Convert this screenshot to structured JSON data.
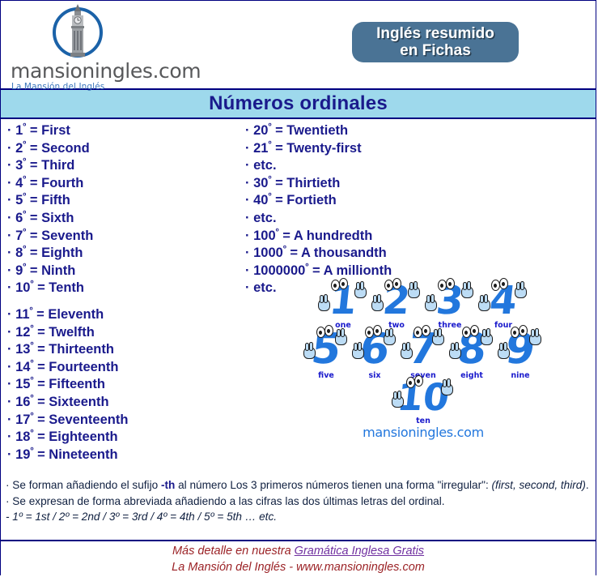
{
  "brand": {
    "name": "mansioningles.com",
    "tagline": "La Mansión del Inglés",
    "logo_icon": "big-ben-clock-tower-icon"
  },
  "header": {
    "badge_line1": "Inglés resumido",
    "badge_line2": "en Fichas",
    "badge_color": "#4a7395"
  },
  "title": {
    "text": "Números ordinales",
    "band_color": "#9ed9ec",
    "text_color": "#1a1a8c"
  },
  "columns": {
    "left": [
      {
        "bullet": "·",
        "num": "1",
        "ord": "º",
        "eq": "=",
        "word": "First"
      },
      {
        "bullet": "·",
        "num": "2",
        "ord": "º",
        "eq": "=",
        "word": "Second"
      },
      {
        "bullet": "·",
        "num": "3",
        "ord": "º",
        "eq": "=",
        "word": "Third"
      },
      {
        "bullet": "·",
        "num": "4",
        "ord": "º",
        "eq": "=",
        "word": "Fourth"
      },
      {
        "bullet": "·",
        "num": "5",
        "ord": "º",
        "eq": "=",
        "word": "Fifth"
      },
      {
        "bullet": "·",
        "num": "6",
        "ord": "º",
        "eq": "=",
        "word": "Sixth"
      },
      {
        "bullet": "·",
        "num": "7",
        "ord": "º",
        "eq": "=",
        "word": "Seventh"
      },
      {
        "bullet": "·",
        "num": "8",
        "ord": "º",
        "eq": "=",
        "word": "Eighth"
      },
      {
        "bullet": "·",
        "num": "9",
        "ord": "º",
        "eq": "=",
        "word": "Ninth"
      },
      {
        "bullet": "·",
        "num": "10",
        "ord": "º",
        "eq": "=",
        "word": "Tenth"
      },
      {
        "spacer": true
      },
      {
        "bullet": "·",
        "num": "11",
        "ord": "º",
        "eq": "=",
        "word": "Eleventh"
      },
      {
        "bullet": "·",
        "num": "12",
        "ord": "º",
        "eq": "=",
        "word": "Twelfth"
      },
      {
        "bullet": "·",
        "num": "13",
        "ord": "º",
        "eq": "=",
        "word": "Thirteenth"
      },
      {
        "bullet": "·",
        "num": "14",
        "ord": "º",
        "eq": "=",
        "word": "Fourteenth"
      },
      {
        "bullet": "·",
        "num": "15",
        "ord": "º",
        "eq": "=",
        "word": "Fifteenth"
      },
      {
        "bullet": "·",
        "num": "16",
        "ord": "º",
        "eq": "=",
        "word": "Sixteenth"
      },
      {
        "bullet": "·",
        "num": "17",
        "ord": "º",
        "eq": "=",
        "word": "Seventeenth"
      },
      {
        "bullet": "·",
        "num": "18",
        "ord": "º",
        "eq": "=",
        "word": "Eighteenth"
      },
      {
        "bullet": "·",
        "num": "19",
        "ord": "º",
        "eq": "=",
        "word": "Nineteenth"
      }
    ],
    "right": [
      {
        "bullet": "·",
        "num": "20",
        "ord": "º",
        "eq": "=",
        "word": "Twentieth"
      },
      {
        "bullet": "·",
        "num": "21",
        "ord": "º",
        "eq": "=",
        "word": "Twenty-first"
      },
      {
        "bullet": "·",
        "text": "etc."
      },
      {
        "bullet": "·",
        "num": "30",
        "ord": "º",
        "eq": "=",
        "word": "Thirtieth"
      },
      {
        "bullet": "·",
        "num": "40",
        "ord": "º",
        "eq": "=",
        "word": "Fortieth"
      },
      {
        "bullet": "·",
        "text": "etc."
      },
      {
        "bullet": "·",
        "num": "100",
        "ord": "º",
        "eq": "=",
        "word": "A hundredth"
      },
      {
        "bullet": "·",
        "num": "1000",
        "ord": "º",
        "eq": "=",
        "word": "A thousandth"
      },
      {
        "bullet": "·",
        "num": "1000000",
        "ord": "º",
        "eq": "=",
        "word": "A millionth"
      },
      {
        "bullet": "·",
        "text": "etc."
      }
    ]
  },
  "illustration": {
    "brand": "mansioningles.com",
    "number_color": "#2277dd",
    "caption_color": "#1a1acc",
    "rows": [
      [
        {
          "glyph": "1",
          "caption": "one"
        },
        {
          "glyph": "2",
          "caption": "two"
        },
        {
          "glyph": "3",
          "caption": "three"
        },
        {
          "glyph": "4",
          "caption": "four"
        }
      ],
      [
        {
          "glyph": "5",
          "caption": "five"
        },
        {
          "glyph": "6",
          "caption": "six"
        },
        {
          "glyph": "7",
          "caption": "seven"
        },
        {
          "glyph": "8",
          "caption": "eight"
        },
        {
          "glyph": "9",
          "caption": "nine"
        }
      ],
      [
        {
          "glyph": "10",
          "caption": "ten"
        }
      ]
    ]
  },
  "notes": {
    "line1_a": "· Se forman añadiendo el sufijo ",
    "line1_bold": "-th",
    "line1_b": " al número Los 3 primeros números tienen una forma \"irregular\": ",
    "line1_italic": "(first, second, third)",
    "line1_c": ".",
    "line2": "· Se expresan de forma abreviada añadiendo a las cifras las dos últimas letras del ordinal.",
    "line3": "- 1º = 1st / 2º = 2nd / 3º = 3rd / 4º = 4th / 5º = 5th … etc."
  },
  "footer": {
    "line1_prefix": "Más detalle en nuestra ",
    "line1_link": "Gramática Inglesa Gratis",
    "line2": "La Mansión del Inglés - www.mansioningles.com",
    "text_color": "#9b2226",
    "link_color": "#7030a0"
  }
}
